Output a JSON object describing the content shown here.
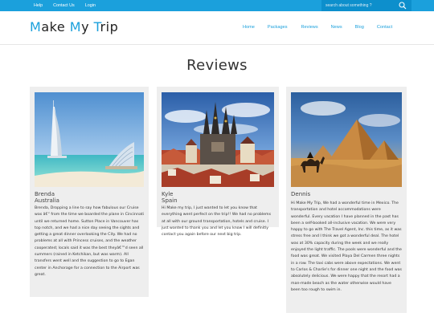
{
  "topbar": {
    "links": [
      "Help",
      "Contact Us",
      "Login"
    ],
    "search_placeholder": "search about something ?"
  },
  "header": {
    "logo": {
      "part1": "M",
      "part2": "ake ",
      "part3": "M",
      "part4": "y ",
      "part5": "T",
      "part6": "rip"
    },
    "nav": [
      "Home",
      "Packages",
      "Reviews",
      "News",
      "Blog",
      "Contact"
    ]
  },
  "main": {
    "title": "Reviews",
    "reviews": [
      {
        "name": "Brenda",
        "location": "Australia",
        "text": "Brenda, Dropping a line to say how fabulous our Cruise was â€“ from the time we boarded the plane in Cincinnati until we returned home. Sutton Place in Vancouver has top notch, and we had a nice day seeing the sights and getting a great dinner overlooking the City. We had no problems at all with Princess cruises, and the weather cooperated; locals said it was the best theyâ€™d seen all summers (rained in Ketchikan, but was warm). All transfers went well and the suggestion to go to Egan center in Anchorage for a connection to the Airport was great."
      },
      {
        "name": "Kyle",
        "location": "Spain",
        "text": "Hi Make my trip, I just wanted to let you know that everything went perfect on the trip!! We had no problems at all with our ground transportation, hotels and cruise. I just wanted to thank you and let you know I will definitly contact you again before our next big trip."
      },
      {
        "name": "Dennis",
        "location": "",
        "text": "Hi Make My Trip, We had a wonderful time in Mexico. The transportation and hotel accommodations were wonderful. Every vacation I have planned in the past has been a self-booked all-inclusive vacation. We were very happy to go with The Travel Agent, Inc. this time, as it was stress free and I think we got a wonderful deal. The hotel was at 30% capacity during the week and we really enjoyed the light traffic. The pools were wonderful and the food was great. We visited Playa Del Carmen three nights in a row. The taxi cabs were above expectations. We went to Carlos & Charlie's for dinner one night and the food was absolutely delicious. We were happy that the resort had a man-made beach as the water otherwise would have been too rough to swim in."
      }
    ]
  },
  "colors": {
    "accent": "#1ba0dc",
    "card_bg": "#eeeeee"
  }
}
